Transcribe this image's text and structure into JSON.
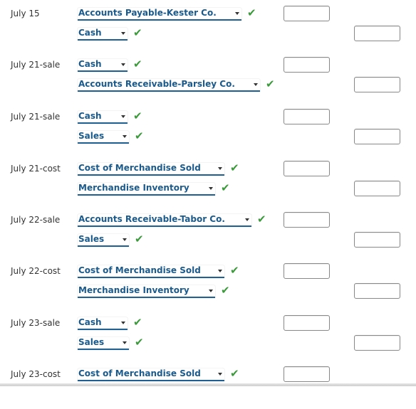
{
  "entries": [
    {
      "date": "July 15",
      "debit": {
        "account": "Accounts Payable-Kester Co.",
        "amount": ""
      },
      "credit": {
        "account": "Cash",
        "amount": ""
      }
    },
    {
      "date": "July 21-sale",
      "debit": {
        "account": "Cash",
        "amount": ""
      },
      "credit": {
        "account": "Accounts Receivable-Parsley Co.",
        "amount": ""
      }
    },
    {
      "date": "July 21-sale",
      "debit": {
        "account": "Cash",
        "amount": ""
      },
      "credit": {
        "account": "Sales",
        "amount": ""
      }
    },
    {
      "date": "July 21-cost",
      "debit": {
        "account": "Cost of Merchandise Sold",
        "amount": ""
      },
      "credit": {
        "account": "Merchandise Inventory",
        "amount": ""
      }
    },
    {
      "date": "July 22-sale",
      "debit": {
        "account": "Accounts Receivable-Tabor Co.",
        "amount": ""
      },
      "credit": {
        "account": "Sales",
        "amount": ""
      }
    },
    {
      "date": "July 22-cost",
      "debit": {
        "account": "Cost of Merchandise Sold",
        "amount": ""
      },
      "credit": {
        "account": "Merchandise Inventory",
        "amount": ""
      }
    },
    {
      "date": "July 23-sale",
      "debit": {
        "account": "Cash",
        "amount": ""
      },
      "credit": {
        "account": "Sales",
        "amount": ""
      }
    },
    {
      "date": "July 23-cost",
      "debit": {
        "account": "Cost of Merchandise Sold",
        "amount": ""
      },
      "credit": null
    }
  ],
  "status_icon": "check-icon",
  "check_glyph": "✔",
  "colors": {
    "select_text": "#1a5a8c",
    "select_underline": "#1f5f91",
    "check": "#3a9a3a"
  }
}
